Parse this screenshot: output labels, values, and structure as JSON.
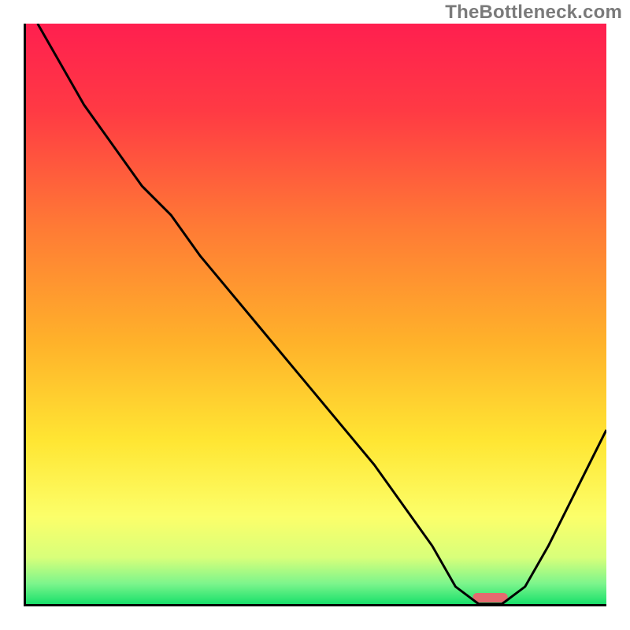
{
  "watermark": "TheBottleneck.com",
  "chart_data": {
    "type": "line",
    "title": "",
    "xlabel": "",
    "ylabel": "",
    "xlim": [
      0,
      100
    ],
    "ylim": [
      0,
      100
    ],
    "x": [
      2,
      10,
      20,
      25,
      30,
      40,
      50,
      60,
      70,
      74,
      78,
      82,
      86,
      90,
      95,
      100
    ],
    "values": [
      100,
      86,
      72,
      67,
      60,
      48,
      36,
      24,
      10,
      3,
      0,
      0,
      3,
      10,
      20,
      30
    ],
    "optimum_marker": {
      "x_center": 80,
      "width": 6
    },
    "background_gradient_stops": [
      {
        "pos": 0.0,
        "color": "#ff1f4f"
      },
      {
        "pos": 0.15,
        "color": "#ff3a44"
      },
      {
        "pos": 0.35,
        "color": "#ff7a35"
      },
      {
        "pos": 0.55,
        "color": "#ffb22a"
      },
      {
        "pos": 0.72,
        "color": "#ffe633"
      },
      {
        "pos": 0.85,
        "color": "#fcff6a"
      },
      {
        "pos": 0.92,
        "color": "#d8ff7a"
      },
      {
        "pos": 0.965,
        "color": "#7cf58c"
      },
      {
        "pos": 1.0,
        "color": "#19e06b"
      }
    ],
    "marker_color": "#e46a6f",
    "curve_color": "#000000"
  }
}
